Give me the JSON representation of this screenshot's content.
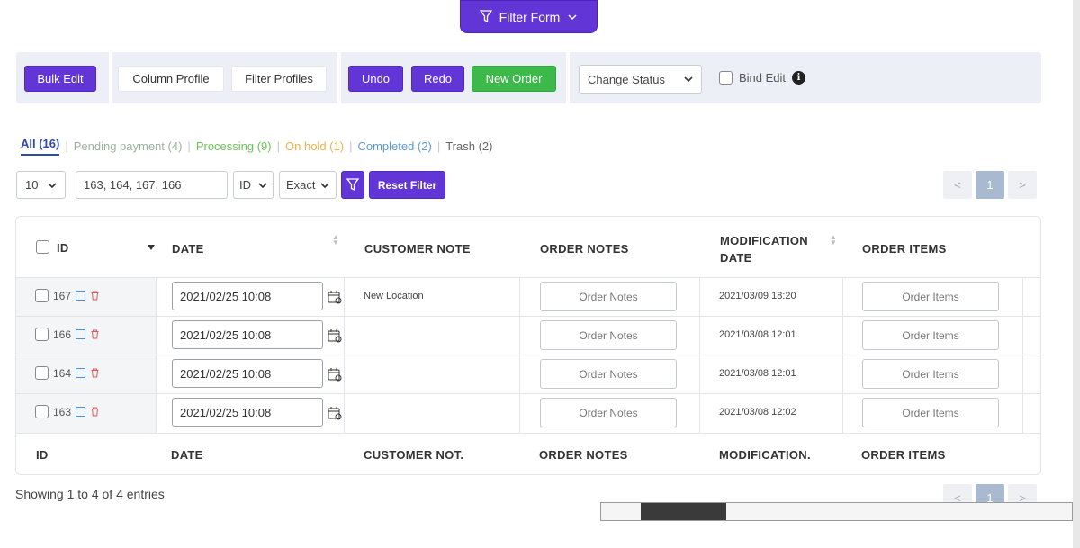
{
  "filter_form": {
    "label": "Filter Form"
  },
  "toolbar": {
    "bulk_edit": "Bulk Edit",
    "column_profile": "Column Profile",
    "filter_profiles": "Filter Profiles",
    "undo": "Undo",
    "redo": "Redo",
    "new_order": "New Order",
    "change_status": "Change Status",
    "bind_edit": "Bind Edit"
  },
  "status_tabs": [
    {
      "label": "All (16)"
    },
    {
      "label": "Pending payment (4)"
    },
    {
      "label": "Processing (9)"
    },
    {
      "label": "On hold (1)"
    },
    {
      "label": "Completed (2)"
    },
    {
      "label": "Trash (2)"
    }
  ],
  "filter_bar": {
    "per_page": "10",
    "ids_value": "163, 164, 167, 166",
    "field": "ID",
    "match": "Exact",
    "reset": "Reset Filter"
  },
  "pagination": {
    "prev": "<",
    "current": "1",
    "next": ">"
  },
  "table": {
    "headers": {
      "id": "ID",
      "date": "DATE",
      "customer_note": "CUSTOMER NOTE",
      "order_notes": "ORDER NOTES",
      "modification_date_line1": "MODIFICATION",
      "modification_date_line2": "DATE",
      "order_items": "ORDER ITEMS"
    },
    "footers": {
      "id": "ID",
      "date": "DATE",
      "customer_note": "CUSTOMER NOT.",
      "order_notes": "ORDER NOTES",
      "modification_date": "MODIFICATION.",
      "order_items": "ORDER ITEMS"
    },
    "rows": [
      {
        "id": "167",
        "date": "2021/02/25 10:08",
        "customer_note": "New Location",
        "order_notes": "Order Notes",
        "modification_date": "2021/03/09 18:20",
        "order_items": "Order Items"
      },
      {
        "id": "166",
        "date": "2021/02/25 10:08",
        "customer_note": "",
        "order_notes": "Order Notes",
        "modification_date": "2021/03/08 12:01",
        "order_items": "Order Items"
      },
      {
        "id": "164",
        "date": "2021/02/25 10:08",
        "customer_note": "",
        "order_notes": "Order Notes",
        "modification_date": "2021/03/08 12:01",
        "order_items": "Order Items"
      },
      {
        "id": "163",
        "date": "2021/02/25 10:08",
        "customer_note": "",
        "order_notes": "Order Notes",
        "modification_date": "2021/03/08 12:02",
        "order_items": "Order Items"
      }
    ]
  },
  "footer": {
    "showing": "Showing 1 to 4 of 4 entries"
  },
  "colors": {
    "primary": "#6236d6",
    "success": "#3cb94a",
    "link": "#2f4aa8"
  }
}
